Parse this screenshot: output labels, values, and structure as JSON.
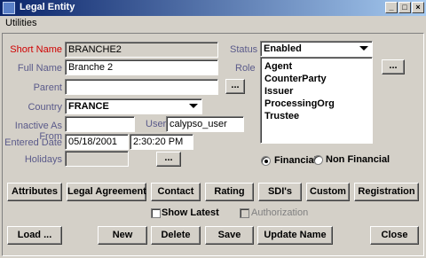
{
  "window": {
    "title": "Legal Entity"
  },
  "menu": {
    "utilities": "Utilities"
  },
  "form": {
    "short_name": {
      "label": "Short Name",
      "value": "BRANCHE2"
    },
    "full_name": {
      "label": "Full Name",
      "value": "Branche 2"
    },
    "parent": {
      "label": "Parent",
      "value": ""
    },
    "country": {
      "label": "Country",
      "value": "FRANCE"
    },
    "inactive_as_from": {
      "label": "Inactive As From",
      "value": ""
    },
    "user": {
      "label": "User",
      "value": "calypso_user"
    },
    "entered_date": {
      "label": "Entered Date",
      "date": "05/18/2001",
      "time": "2:30:20 PM"
    },
    "holidays": {
      "label": "Holidays",
      "value": ""
    },
    "status": {
      "label": "Status",
      "value": "Enabled"
    },
    "role": {
      "label": "Role",
      "items": [
        "Agent",
        "CounterParty",
        "Issuer",
        "ProcessingOrg",
        "Trustee"
      ]
    },
    "ellipsis": "...",
    "financial": "Financial",
    "non_financial": "Non Financial",
    "show_latest": "Show Latest",
    "authorization": "Authorization"
  },
  "tabs": [
    "Attributes",
    "Legal Agreement",
    "Contact",
    "Rating",
    "SDI's",
    "Custom",
    "Registration"
  ],
  "actions": {
    "load": "Load ...",
    "new": "New",
    "delete": "Delete",
    "save": "Save",
    "update_name": "Update Name",
    "close": "Close"
  }
}
